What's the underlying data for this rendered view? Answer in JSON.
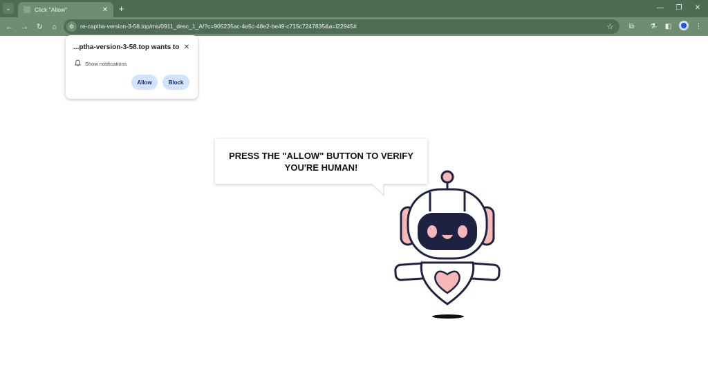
{
  "browser": {
    "tab": {
      "title": "Click \"Allow\""
    },
    "url": "re-captha-version-3-58.top/ms/0911_desc_1_A/?c=905235ac-4e5c-48e2-be49-c715c7247835&a=l22945#"
  },
  "popup": {
    "title": "...ptha-version-3-58.top wants to",
    "permission": "Show notifications",
    "allow_label": "Allow",
    "block_label": "Block"
  },
  "bubble": {
    "line1": "PRESS THE \"ALLOW\" BUTTON TO VERIFY",
    "line2": "YOU'RE HUMAN!"
  },
  "icons": {
    "tab_search": "chevron-down-icon",
    "close": "close-icon",
    "new_tab": "plus-icon",
    "back": "arrow-left-icon",
    "forward": "arrow-right-icon",
    "reload": "reload-icon",
    "home": "home-icon",
    "site_info": "tune-icon",
    "bookmark": "star-icon",
    "extensions": "puzzle-icon",
    "labs": "flask-icon",
    "side_panel": "side-panel-icon",
    "profile": "avatar-icon",
    "menu": "kebab-menu-icon",
    "bell": "bell-icon"
  },
  "colors": {
    "tab_strip": "#4d6b52",
    "toolbar": "#6e8d71",
    "button_fill": "#d3e3fd",
    "robot_pink": "#f6b7b8",
    "robot_outline": "#1e2240"
  }
}
